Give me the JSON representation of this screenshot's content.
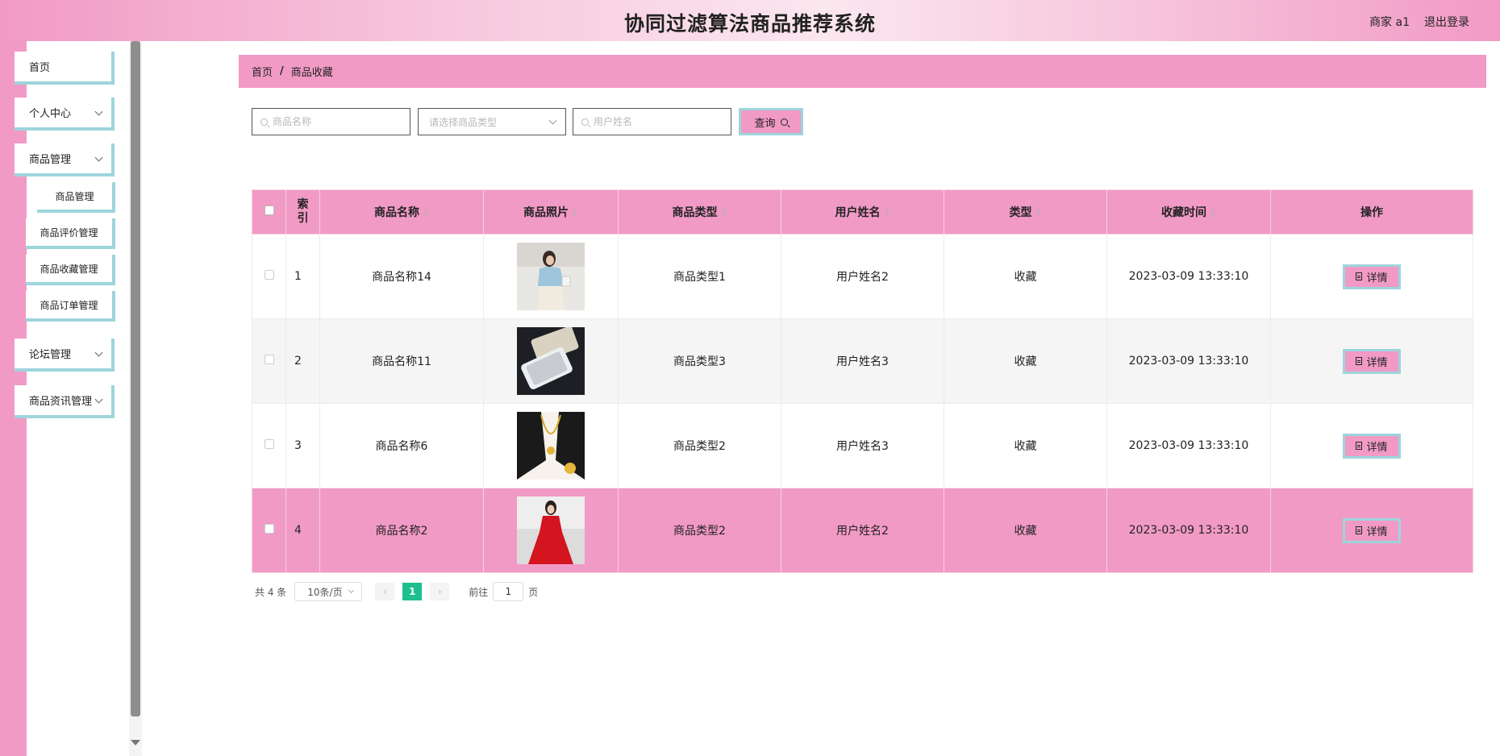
{
  "header": {
    "title": "协同过滤算法商品推荐系统",
    "user": "商家 a1",
    "logout": "退出登录"
  },
  "colors": {
    "primary": "#f19ac6",
    "accent": "#9dd5dc",
    "page_active": "#1dbf8e"
  },
  "sidebar": {
    "items": [
      {
        "label": "首页"
      },
      {
        "label": "个人中心"
      },
      {
        "label": "商品管理"
      },
      {
        "label": "论坛管理"
      },
      {
        "label": "商品资讯管理"
      }
    ],
    "sub_items": [
      {
        "label": "商品管理"
      },
      {
        "label": "商品评价管理"
      },
      {
        "label": "商品收藏管理"
      },
      {
        "label": "商品订单管理"
      }
    ]
  },
  "breadcrumb": {
    "home": "首页",
    "separator": "/",
    "current": "商品收藏"
  },
  "search": {
    "name_placeholder": "商品名称",
    "type_placeholder": "请选择商品类型",
    "user_placeholder": "用户姓名",
    "query_label": "查询"
  },
  "table": {
    "headers": {
      "index": "索引",
      "name": "商品名称",
      "photo": "商品照片",
      "type": "商品类型",
      "user": "用户姓名",
      "kind": "类型",
      "time": "收藏时间",
      "action": "操作"
    },
    "detail_label": "详情",
    "rows": [
      {
        "index": "1",
        "name": "商品名称14",
        "photo": "blouse-photo",
        "type": "商品类型1",
        "user": "用户姓名2",
        "kind": "收藏",
        "time": "2023-03-09 13:33:10"
      },
      {
        "index": "2",
        "name": "商品名称11",
        "photo": "phone-photo",
        "type": "商品类型3",
        "user": "用户姓名3",
        "kind": "收藏",
        "time": "2023-03-09 13:33:10"
      },
      {
        "index": "3",
        "name": "商品名称6",
        "photo": "necklace-photo",
        "type": "商品类型2",
        "user": "用户姓名3",
        "kind": "收藏",
        "time": "2023-03-09 13:33:10"
      },
      {
        "index": "4",
        "name": "商品名称2",
        "photo": "red-dress-photo",
        "type": "商品类型2",
        "user": "用户姓名2",
        "kind": "收藏",
        "time": "2023-03-09 13:33:10"
      }
    ]
  },
  "pagination": {
    "total": "共 4 条",
    "page_size": "10条/页",
    "prev": "‹",
    "current_page": "1",
    "next": "›",
    "goto_label": "前往",
    "goto_value": "1",
    "page_suffix": "页"
  }
}
